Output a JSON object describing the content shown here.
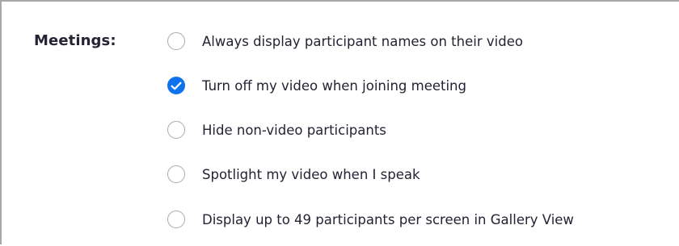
{
  "settings": {
    "section_label": "Meetings:",
    "options": [
      {
        "label": "Always display participant names on their video",
        "checked": false
      },
      {
        "label": "Turn off my video when joining meeting",
        "checked": true
      },
      {
        "label": "Hide non-video participants",
        "checked": false
      },
      {
        "label": "Spotlight my video when I speak",
        "checked": false
      },
      {
        "label": "Display up to 49 participants per screen in Gallery View",
        "checked": false
      }
    ]
  },
  "icons": {
    "checked": "checkmark-icon",
    "unchecked": "empty-circle-icon"
  },
  "colors": {
    "accent": "#0e72ed",
    "text": "#232333",
    "checkbox_border": "#a9a9b0",
    "frame_border": "#a8a8a8"
  }
}
